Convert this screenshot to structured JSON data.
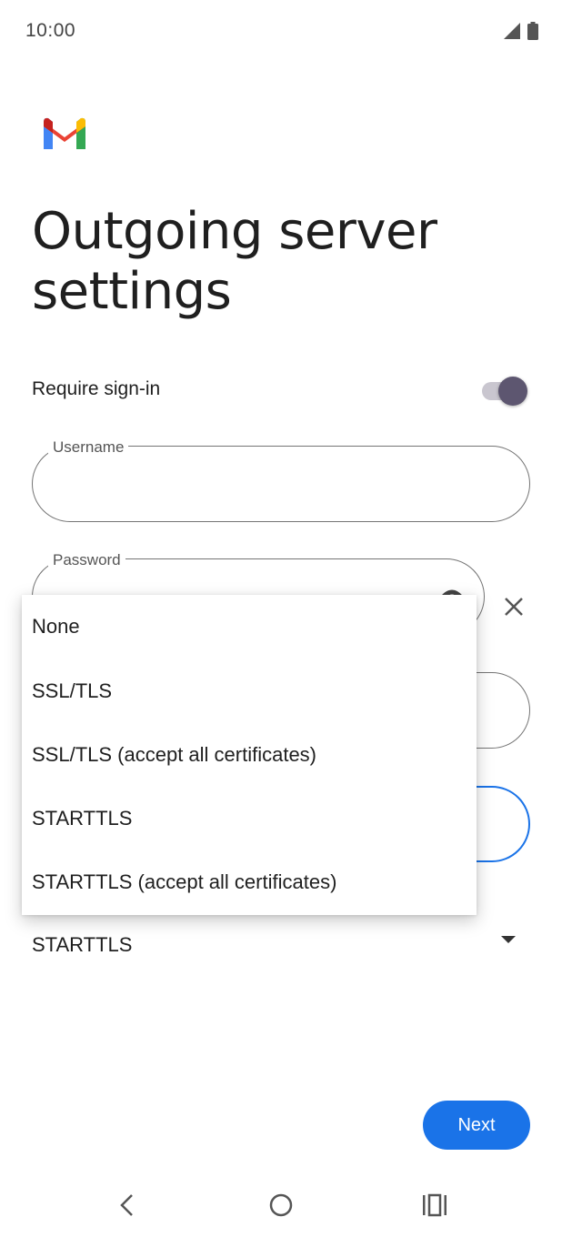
{
  "status_bar": {
    "time": "10:00",
    "icons": [
      "signal-icon",
      "battery-icon"
    ]
  },
  "app": {
    "logo": "gmail-logo",
    "brand_colors": [
      "#4285f4",
      "#ea4335",
      "#fbbc04",
      "#34a853"
    ]
  },
  "page": {
    "title": "Outgoing server settings"
  },
  "require_signin": {
    "label": "Require sign-in",
    "enabled": true
  },
  "fields": {
    "username": {
      "label": "Username",
      "value": ""
    },
    "password": {
      "label": "Password",
      "value": ""
    }
  },
  "security_dropdown": {
    "selected": "STARTTLS",
    "options": [
      "None",
      "SSL/TLS",
      "SSL/TLS (accept all certificates)",
      "STARTTLS",
      "STARTTLS (accept all certificates)"
    ]
  },
  "actions": {
    "next_label": "Next",
    "accent_color": "#1a73e8"
  },
  "nav_bar": {
    "icons": [
      "back-icon",
      "home-icon",
      "recents-icon"
    ]
  }
}
